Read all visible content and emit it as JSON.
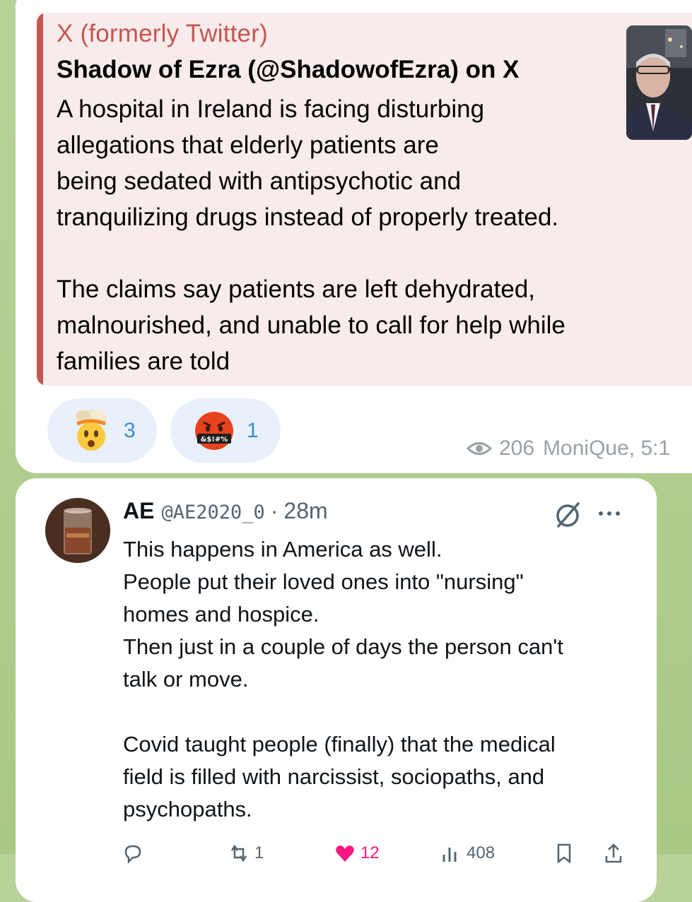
{
  "link_preview": {
    "site_name": "X (formerly Twitter)",
    "title": "Shadow of Ezra (@ShadowofEzra) on X",
    "description": "A hospital in Ireland is facing disturbing\nallegations that elderly patients are\nbeing sedated with antipsychotic and\ntranquilizing drugs instead of properly treated.\n\nThe claims say patients are left dehydrated,\nmalnourished, and unable to call for help while\nfamilies are told",
    "accent_color": "#c4564f",
    "thumbnail_icon": "person-photo"
  },
  "reactions": [
    {
      "emoji": "exploding-head",
      "count": "3"
    },
    {
      "emoji": "cursing-face",
      "count": "1"
    }
  ],
  "message_meta": {
    "views": "206",
    "author_time": "MoniQue, 5:1"
  },
  "tweet": {
    "name": "AE",
    "handle": "@AE2020_0",
    "separator": "·",
    "time": "28m",
    "text": "This happens in America as well.\nPeople put their loved ones into \"nursing\"\nhomes and hospice.\nThen just in a couple of days the person can't\ntalk or move.\n\nCovid taught people (finally) that the medical\nfield is filled with narcissist,  sociopaths, and\npsychopaths.",
    "actions": {
      "reply_count": "",
      "retweet_count": "1",
      "like_count": "12",
      "views_count": "408"
    }
  }
}
